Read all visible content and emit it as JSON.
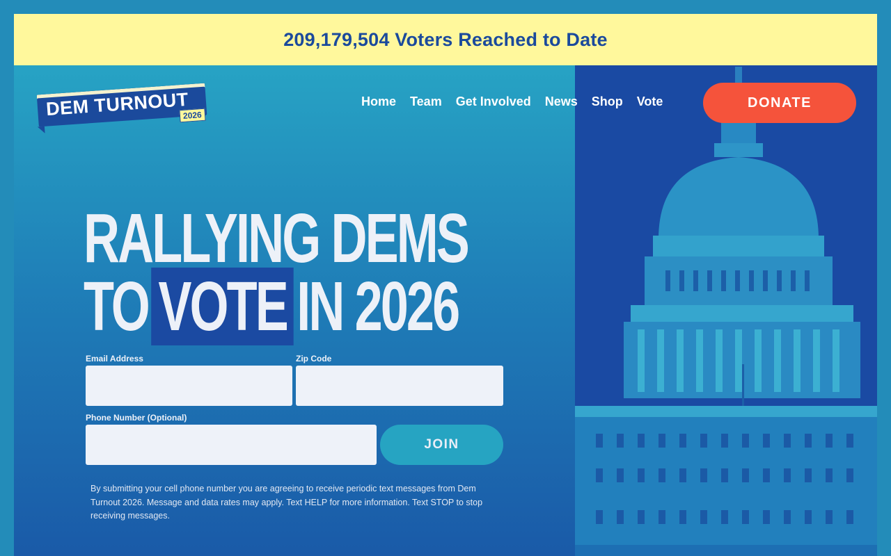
{
  "banner": {
    "text": "209,179,504 Voters Reached to Date"
  },
  "logo": {
    "wordmark": "DEM TURNOUT",
    "year": "2026"
  },
  "nav": {
    "items": [
      {
        "label": "Home"
      },
      {
        "label": "Team"
      },
      {
        "label": "Get Involved"
      },
      {
        "label": "News"
      },
      {
        "label": "Shop"
      },
      {
        "label": "Vote"
      }
    ],
    "donate_label": "DONATE"
  },
  "hero": {
    "headline_line1": "RALLYING DEMS",
    "headline_line2_pre": "TO",
    "headline_line2_highlight": "VOTE",
    "headline_line2_post": "IN 2026"
  },
  "form": {
    "email_label": "Email Address",
    "email_value": "",
    "zip_label": "Zip Code",
    "zip_value": "",
    "phone_label": "Phone Number (Optional)",
    "phone_value": "",
    "join_label": "JOIN",
    "disclaimer": "By submitting your cell phone number you are agreeing to receive periodic text messages from Dem Turnout 2026. Message and data rates may apply. Text HELP for more information. Text STOP to stop receiving messages."
  },
  "colors": {
    "banner_bg": "#fff89c",
    "banner_text": "#1b4a9c",
    "donate_bg": "#f5533b",
    "join_bg": "#26a4c2",
    "highlight_bg": "#1b4aa2"
  }
}
